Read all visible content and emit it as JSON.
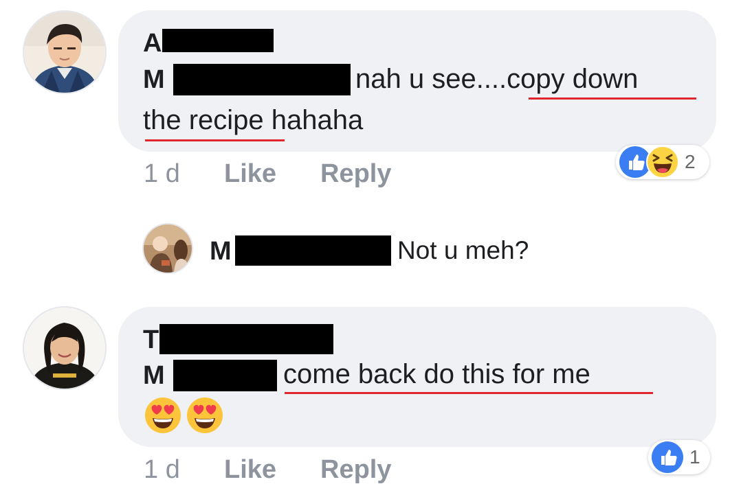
{
  "comments": [
    {
      "author_visible": "A",
      "mention_visible": "M",
      "text_line1": "nah u see....copy down",
      "text_line2_a": "the recipe",
      "text_line2_b": " hahaha",
      "time": "1 d",
      "like_label": "Like",
      "reply_label": "Reply",
      "reactions": [
        "like-icon",
        "haha-icon"
      ],
      "reaction_count": "2"
    },
    {
      "author_visible": "M",
      "text": "Not u meh?"
    },
    {
      "author_visible": "T",
      "mention_visible": "M",
      "text_line1": "come back do this for me",
      "emojis": [
        "heart-eyes-icon",
        "heart-eyes-icon"
      ],
      "time": "1 d",
      "like_label": "Like",
      "reply_label": "Reply",
      "reactions": [
        "like-icon"
      ],
      "reaction_count": "1"
    }
  ],
  "colors": {
    "bubble": "#f0f1f4",
    "meta": "#8d949e",
    "like_blue": "#3b7df2",
    "haha_yellow": "#fbd343",
    "underline_red": "#e0252f"
  }
}
